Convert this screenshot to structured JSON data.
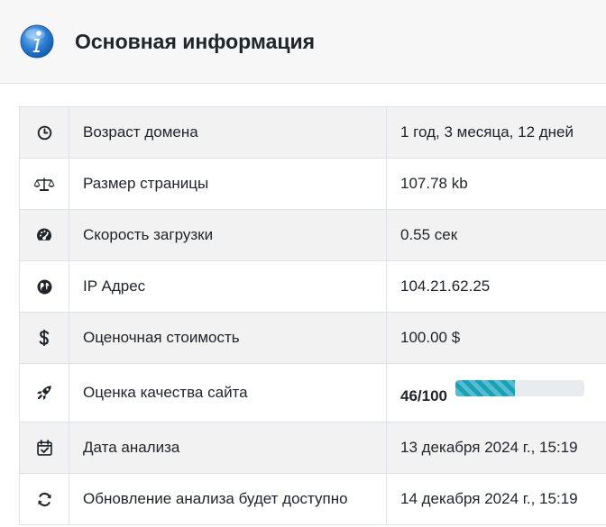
{
  "header": {
    "title": "Основная информация",
    "icon": "info-icon",
    "icon_color": "#2a7fd4"
  },
  "rows": [
    {
      "icon": "clock-icon",
      "label": "Возраст домена",
      "value": "1 год, 3 месяца, 12 дней"
    },
    {
      "icon": "balance-scale-icon",
      "label": "Размер страницы",
      "value": "107.78 kb"
    },
    {
      "icon": "tachometer-icon",
      "label": "Скорость загрузки",
      "value": "0.55 сек"
    },
    {
      "icon": "globe-icon",
      "label": "IP Адрес",
      "value": "104.21.62.25"
    },
    {
      "icon": "dollar-icon",
      "label": "Оценочная стоимость",
      "value": "100.00 $"
    },
    {
      "icon": "rocket-icon",
      "label": "Оценка качества сайта",
      "value": "46/100",
      "progress": 0.46,
      "progress_color": "#17a2b8"
    },
    {
      "icon": "calendar-check-icon",
      "label": "Дата анализа",
      "value": "13 декабря 2024 г., 15:19"
    },
    {
      "icon": "refresh-icon",
      "label": "Обновление анализа будет доступно",
      "value": "14 декабря 2024 г., 15:19"
    }
  ]
}
